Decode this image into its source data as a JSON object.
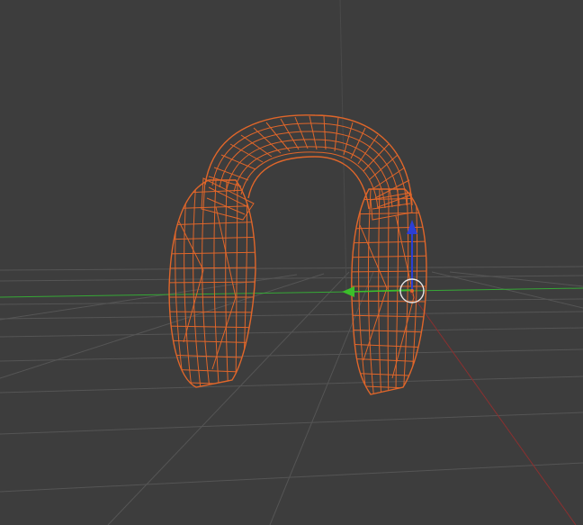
{
  "viewport": {
    "view": "perspective",
    "shading": "wireframe",
    "background_color": "#3d3d3d"
  },
  "scene": {
    "selected_object": "headphones-mesh",
    "selection_color": "#e0662a",
    "grid_color": "#555555",
    "x_axis_color": "#b33a3a",
    "y_axis_color": "#36a836",
    "z_axis_color": "#4a4a4a"
  },
  "gizmo": {
    "type": "translate",
    "z_handle_color": "#2b3fd6",
    "y_handle_color": "#3bbf2a",
    "cursor_ring_color": "#e8e8e8"
  }
}
